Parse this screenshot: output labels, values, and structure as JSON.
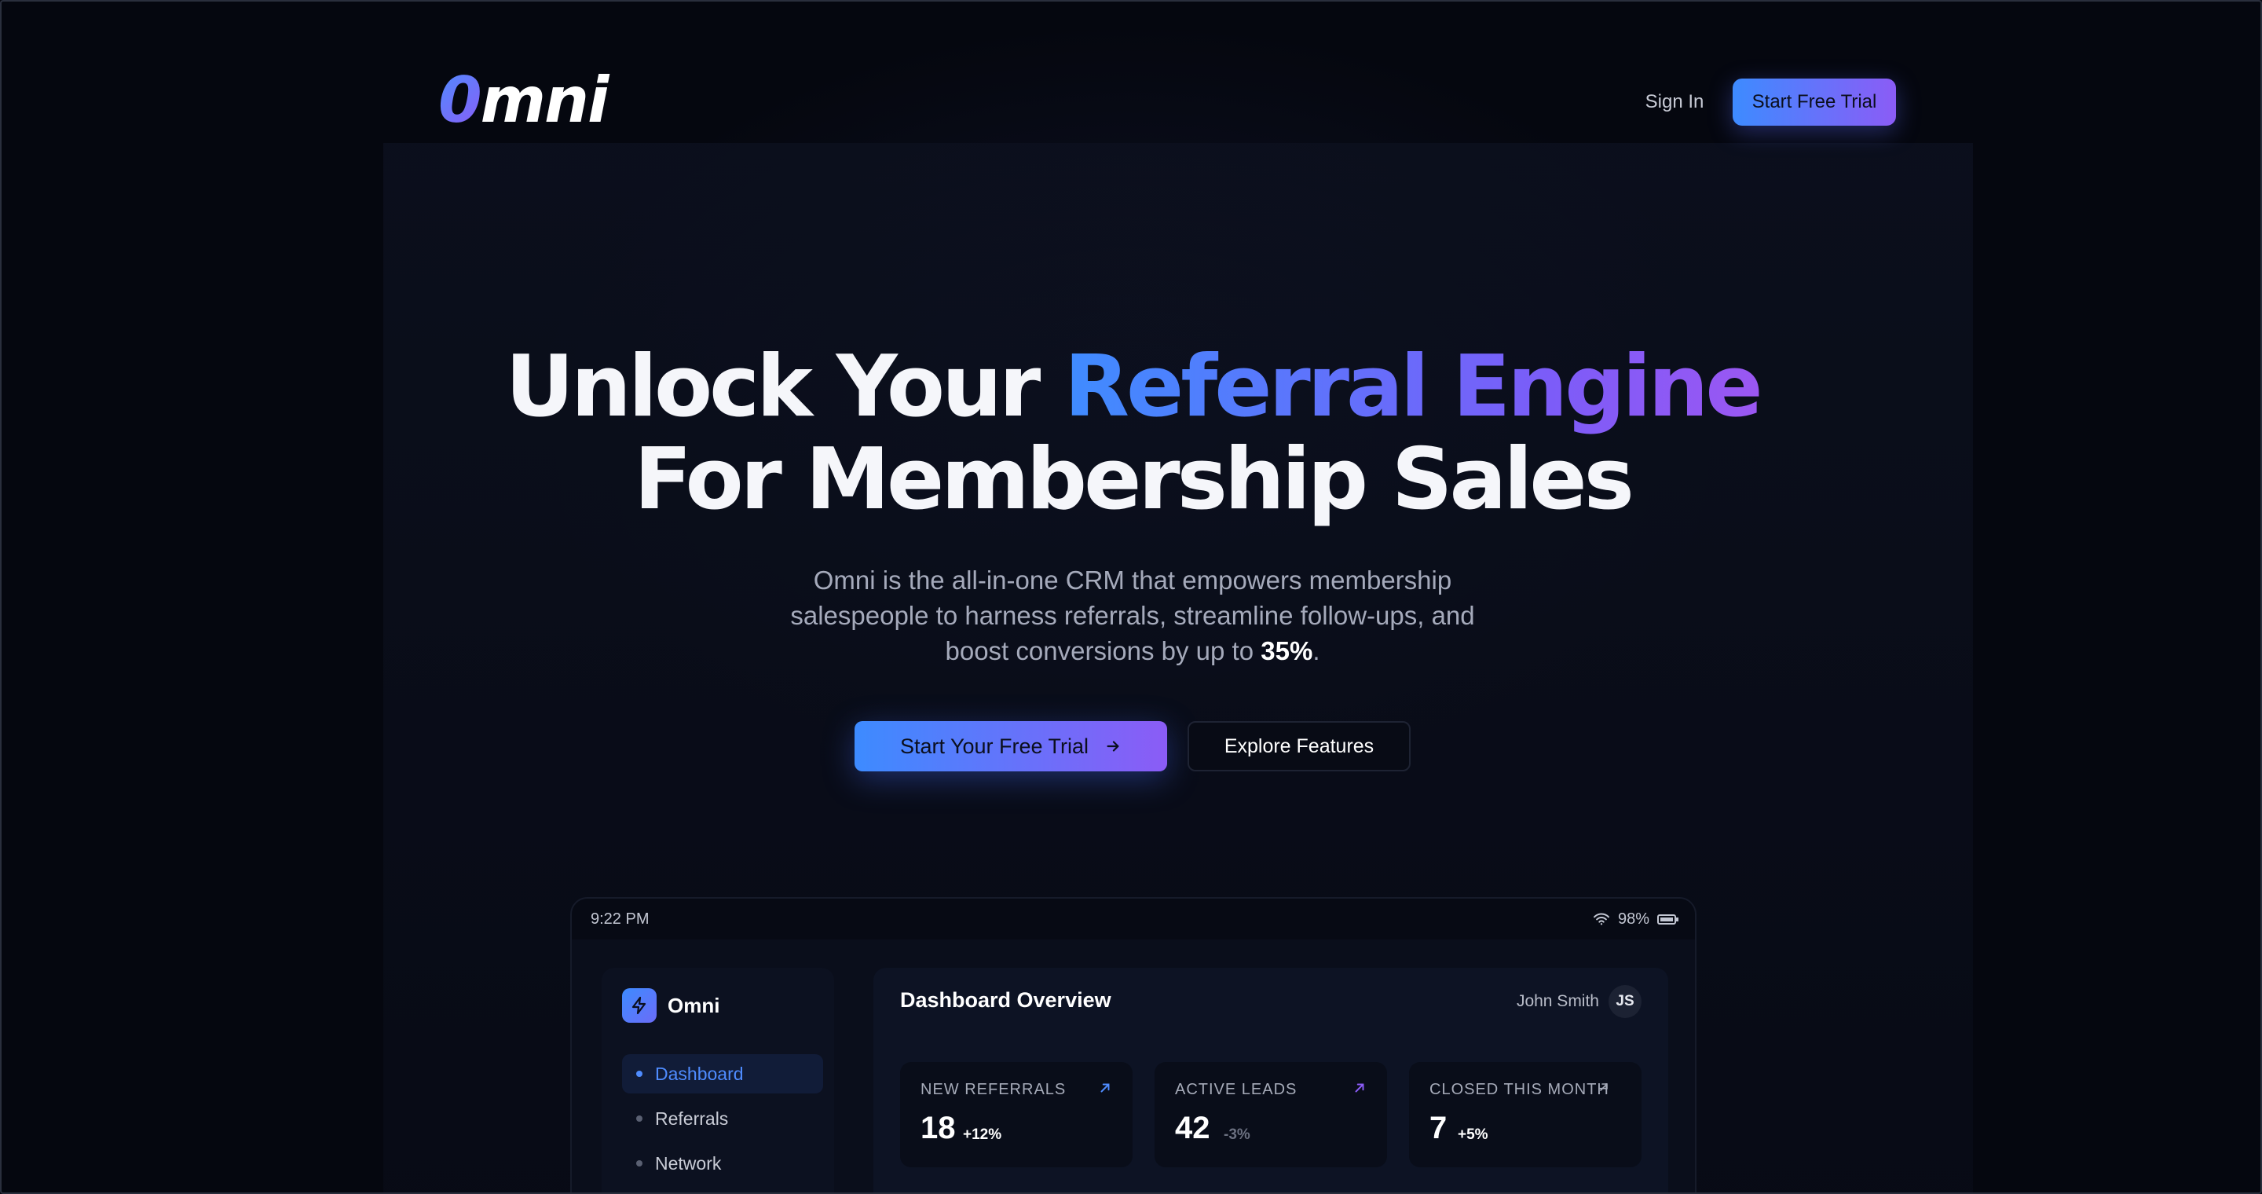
{
  "header": {
    "logo_mark": "0",
    "logo_rest": "mni",
    "signin_label": "Sign In",
    "trial_label": "Start Free Trial"
  },
  "hero": {
    "headline_part1": "Unlock Your ",
    "headline_highlight": "Referral Engine",
    "headline_line2": "For Membership Sales",
    "subtext_pre": "Omni is the all-in-one CRM that empowers membership salespeople to harness referrals, streamline follow-ups, and boost conversions by up to ",
    "subtext_highlight": "35%",
    "subtext_post": ".",
    "primary_cta": "Start Your Free Trial",
    "primary_cta_icon": "arrow-right-icon",
    "secondary_cta": "Explore Features"
  },
  "device": {
    "status": {
      "time": "9:22 PM",
      "battery": "98%",
      "battery_level": 0.98
    },
    "sidebar": {
      "brand": "Omni",
      "items": [
        {
          "label": "Dashboard",
          "active": true
        },
        {
          "label": "Referrals",
          "active": false
        },
        {
          "label": "Network",
          "active": false
        }
      ]
    },
    "main": {
      "title": "Dashboard Overview",
      "user_name": "John Smith",
      "user_initials": "JS",
      "stats": [
        {
          "label": "NEW REFERRALS",
          "value": "18",
          "change": "+12%",
          "change_color": "#ffffff",
          "arrow_color": "#4f8cff"
        },
        {
          "label": "ACTIVE LEADS",
          "value": "42",
          "change": "-3%",
          "change_color": "#6b7080",
          "arrow_color": "#8b5cf6"
        },
        {
          "label": "CLOSED THIS MONTH",
          "value": "7",
          "change": "+5%",
          "change_color": "#ffffff",
          "arrow_color": "#a6abb9"
        }
      ]
    }
  },
  "colors": {
    "background": "#05070f",
    "accent_blue": "#3d8bff",
    "accent_purple": "#8b5cf6"
  }
}
